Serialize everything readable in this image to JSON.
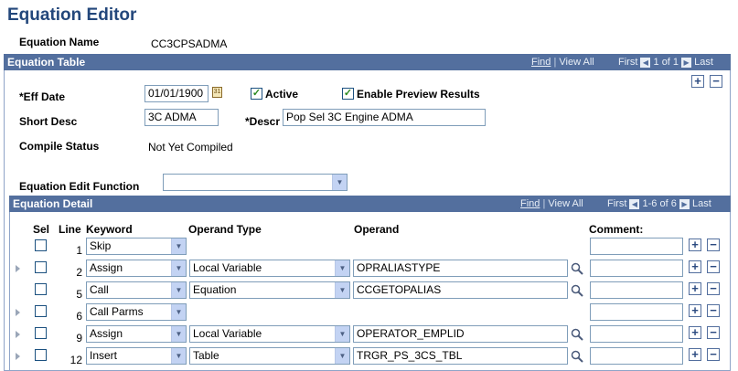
{
  "page": {
    "title": "Equation Editor"
  },
  "equation": {
    "name_label": "Equation Name",
    "name_value": "CC3CPSADMA"
  },
  "equation_table": {
    "title": "Equation Table",
    "find": "Find",
    "view_all": "View All",
    "first": "First",
    "count": "1 of 1",
    "last": "Last",
    "eff_date_label": "*Eff Date",
    "eff_date_value": "01/01/1900",
    "active_label": "Active",
    "active_checked": true,
    "enable_preview_label": "Enable Preview Results",
    "enable_preview_checked": true,
    "short_desc_label": "Short Desc",
    "short_desc_value": "3C ADMA",
    "descr_label": "*Descr",
    "descr_value": "Pop Sel 3C Engine ADMA",
    "compile_status_label": "Compile Status",
    "compile_status_value": "Not Yet Compiled",
    "edit_function_label": "Equation Edit Function",
    "edit_function_value": ""
  },
  "equation_detail": {
    "title": "Equation Detail",
    "find": "Find",
    "view_all": "View All",
    "first": "First",
    "count": "1-6 of 6",
    "last": "Last",
    "columns": {
      "sel": "Sel",
      "line": "Line",
      "keyword": "Keyword",
      "operand_type": "Operand Type",
      "operand": "Operand",
      "comment": "Comment:"
    },
    "rows": [
      {
        "line": "1",
        "keyword": "Skip",
        "operand_type": null,
        "operand": null,
        "expand": false
      },
      {
        "line": "2",
        "keyword": "Assign",
        "operand_type": "Local Variable",
        "operand": "OPRALIASTYPE",
        "expand": true
      },
      {
        "line": "5",
        "keyword": "Call",
        "operand_type": "Equation",
        "operand": "CCGETOPALIAS",
        "expand": false
      },
      {
        "line": "6",
        "keyword": "Call Parms",
        "operand_type": null,
        "operand": null,
        "expand": true
      },
      {
        "line": "9",
        "keyword": "Assign",
        "operand_type": "Local Variable",
        "operand": "OPERATOR_EMPLID",
        "expand": true
      },
      {
        "line": "12",
        "keyword": "Insert",
        "operand_type": "Table",
        "operand": "TRGR_PS_3CS_TBL",
        "expand": true
      }
    ]
  },
  "colors": {
    "bar": "#536f9e",
    "title": "#23477b"
  },
  "icons": {
    "lookup": "magnifier-icon",
    "calendar": "calendar-icon",
    "add": "plus",
    "delete": "minus"
  }
}
